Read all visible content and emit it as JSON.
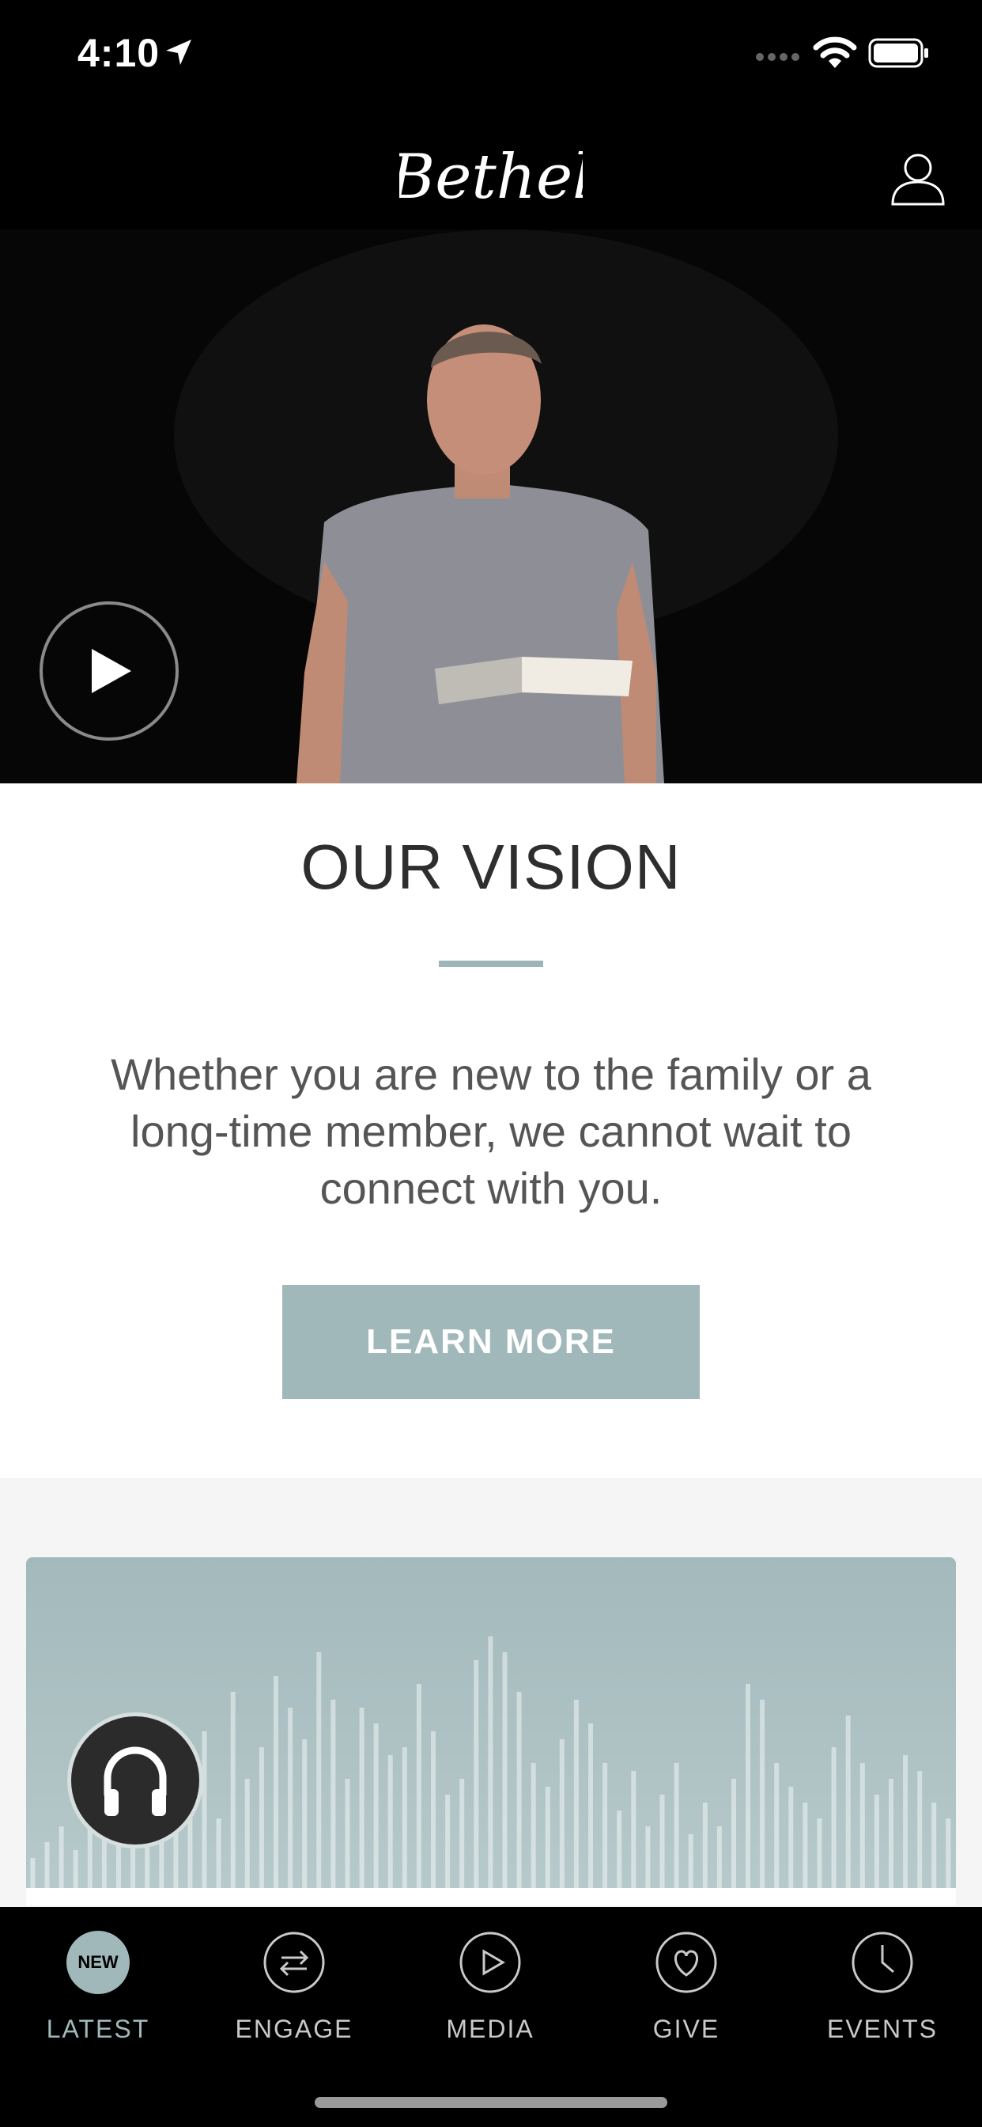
{
  "status_bar": {
    "time": "4:10"
  },
  "header": {
    "logo_text": "Bethel"
  },
  "hero": {
    "play_icon": "play-icon"
  },
  "vision": {
    "title": "OUR VISION",
    "text": "Whether you are new to the family or a long-time member, we cannot wait to connect with you.",
    "button_label": "LEARN MORE"
  },
  "audio_card": {
    "icon": "headphones-icon"
  },
  "tab_bar": {
    "active": "LATEST",
    "tabs": [
      {
        "label": "LATEST",
        "icon": "new-badge",
        "badge": "NEW"
      },
      {
        "label": "ENGAGE",
        "icon": "exchange-arrows-icon"
      },
      {
        "label": "MEDIA",
        "icon": "play-circle-icon"
      },
      {
        "label": "GIVE",
        "icon": "heart-circle-icon"
      },
      {
        "label": "EVENTS",
        "icon": "clock-icon"
      }
    ]
  },
  "colors": {
    "accent": "#a1b8ba",
    "dark": "#000000",
    "text": "#2e2e2e"
  }
}
